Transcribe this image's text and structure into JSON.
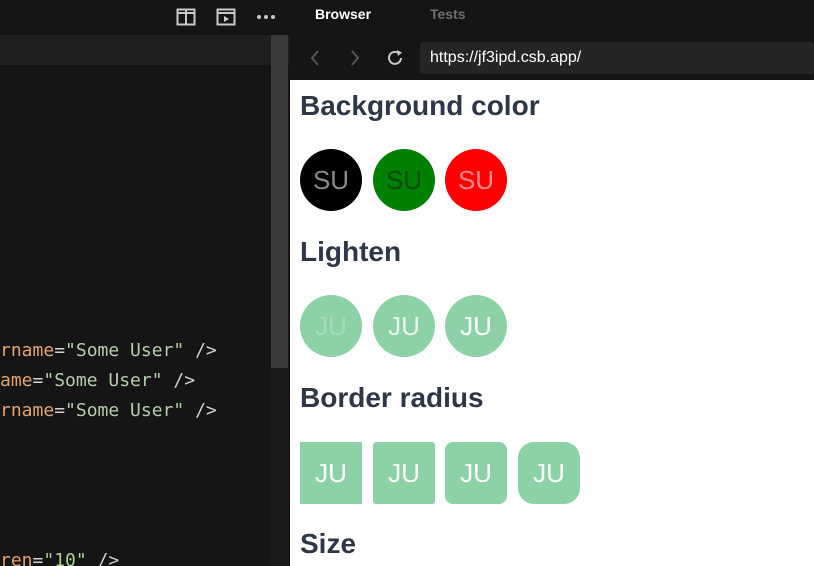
{
  "editor": {
    "code_lines": [
      {
        "attr": "rname",
        "eq": "=",
        "str": "\"Some User\"",
        "tail": " />"
      },
      {
        "attr": "ame",
        "eq": "=",
        "str": "\"Some User\"",
        "tail": " />"
      },
      {
        "attr": "rname",
        "eq": "=",
        "str": "\"Some User\"",
        "tail": " />"
      },
      {
        "attr": "ren",
        "eq": "=",
        "str": "\"10\"",
        "tail": " />"
      }
    ]
  },
  "browser": {
    "tabs": [
      "Browser",
      "Tests"
    ],
    "url": "https://jf3ipd.csb.app/"
  },
  "page": {
    "sections": [
      {
        "title": "Background color",
        "avatars": [
          {
            "initials": "SU",
            "bg": "#000000",
            "fg": "#8a8a8a",
            "shape": "circle"
          },
          {
            "initials": "SU",
            "bg": "#008000",
            "fg": "#0b4a0b",
            "shape": "circle"
          },
          {
            "initials": "SU",
            "bg": "#ff0000",
            "fg": "#ff8a8a",
            "shape": "circle"
          }
        ]
      },
      {
        "title": "Lighten",
        "avatars": [
          {
            "initials": "JU",
            "bg": "#8dd1a6",
            "fg": "#a5dbb9",
            "shape": "circle"
          },
          {
            "initials": "JU",
            "bg": "#8dd1a6",
            "fg": "#e6f6ec",
            "shape": "circle"
          },
          {
            "initials": "JU",
            "bg": "#8dd1a6",
            "fg": "#ffffff",
            "shape": "circle"
          }
        ]
      },
      {
        "title": "Border radius",
        "avatars": [
          {
            "initials": "JU",
            "bg": "#8dd1a6",
            "fg": "#ffffff",
            "shape": "square"
          },
          {
            "initials": "JU",
            "bg": "#8dd1a6",
            "fg": "#ffffff",
            "shape": "rounded-sm"
          },
          {
            "initials": "JU",
            "bg": "#8dd1a6",
            "fg": "#ffffff",
            "shape": "rounded-md"
          },
          {
            "initials": "JU",
            "bg": "#8dd1a6",
            "fg": "#ffffff",
            "shape": "rounded-lg"
          }
        ]
      },
      {
        "title": "Size",
        "avatars": []
      }
    ]
  },
  "icons": {
    "split": "split-view-icon",
    "preview": "preview-icon",
    "more": "more-icon",
    "back": "back-arrow-icon",
    "forward": "forward-arrow-icon",
    "refresh": "refresh-icon"
  }
}
